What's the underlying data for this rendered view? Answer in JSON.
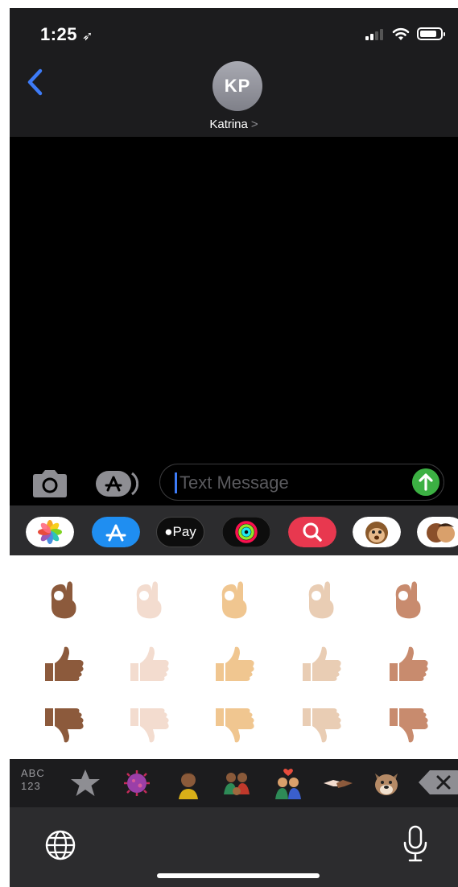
{
  "status": {
    "time": "1:25",
    "location_icon": "location-arrow-icon"
  },
  "nav": {
    "back_icon": "chevron-left-icon",
    "avatar_initials": "KP",
    "contact_name": "Katrina",
    "contact_chevron": ">"
  },
  "compose": {
    "placeholder": "Text Message",
    "camera_icon": "camera-icon",
    "appstore_icon": "app-store-icon",
    "send_icon": "arrow-up-icon"
  },
  "apps": [
    {
      "name": "photos-app-icon"
    },
    {
      "name": "app-store-icon"
    },
    {
      "name": "apple-pay-icon",
      "label": "Pay"
    },
    {
      "name": "activity-rings-icon"
    },
    {
      "name": "search-images-icon"
    },
    {
      "name": "animoji-monkey-icon"
    },
    {
      "name": "memoji-icon"
    }
  ],
  "emoji_grid": {
    "rows": [
      {
        "kind": "ok-hand",
        "tones": [
          "medium-dark",
          "light",
          "medium-light",
          "light",
          "medium"
        ]
      },
      {
        "kind": "thumbs-up",
        "tones": [
          "medium-dark",
          "light",
          "medium-light",
          "light",
          "medium"
        ]
      },
      {
        "kind": "thumbs-down",
        "tones": [
          "medium-dark",
          "light",
          "medium-light",
          "light",
          "medium"
        ]
      }
    ]
  },
  "categories": {
    "abc_label": "ABC",
    "num_label": "123",
    "items": [
      "star-icon",
      "virus-icon",
      "person-icon",
      "family-icon",
      "couple-heart-icon",
      "handshake-icon",
      "dog-icon"
    ],
    "delete_icon": "backspace-icon"
  },
  "bottom": {
    "globe_icon": "globe-icon",
    "mic_icon": "microphone-icon"
  },
  "colors": {
    "send": "#3cb043",
    "accent": "#3d7bf7",
    "bar": "#1c1c1e"
  }
}
